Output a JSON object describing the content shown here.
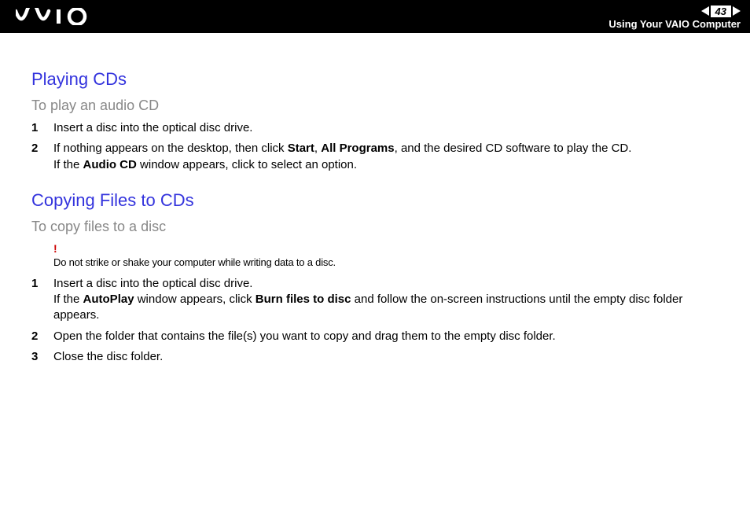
{
  "header": {
    "page_number": "43",
    "section_label": "Using Your VAIO Computer"
  },
  "sections": [
    {
      "title": "Playing CDs",
      "subtitle": "To play an audio CD",
      "steps": [
        {
          "lines": [
            {
              "parts": [
                {
                  "t": "Insert a disc into the optical disc drive."
                }
              ]
            }
          ]
        },
        {
          "lines": [
            {
              "parts": [
                {
                  "t": "If nothing appears on the desktop, then click "
                },
                {
                  "t": "Start",
                  "b": true
                },
                {
                  "t": ", "
                },
                {
                  "t": "All Programs",
                  "b": true
                },
                {
                  "t": ", and the desired CD software to play the CD."
                }
              ]
            },
            {
              "parts": [
                {
                  "t": "If the "
                },
                {
                  "t": "Audio CD",
                  "b": true
                },
                {
                  "t": " window appears, click to select an option."
                }
              ]
            }
          ]
        }
      ]
    },
    {
      "title": "Copying Files to CDs",
      "subtitle": "To copy files to a disc",
      "caution": "Do not strike or shake your computer while writing data to a disc.",
      "steps": [
        {
          "lines": [
            {
              "parts": [
                {
                  "t": "Insert a disc into the optical disc drive."
                }
              ]
            },
            {
              "parts": [
                {
                  "t": "If the "
                },
                {
                  "t": "AutoPlay",
                  "b": true
                },
                {
                  "t": " window appears, click "
                },
                {
                  "t": "Burn files to disc",
                  "b": true
                },
                {
                  "t": " and follow the on-screen instructions until the empty disc folder appears."
                }
              ]
            }
          ]
        },
        {
          "lines": [
            {
              "parts": [
                {
                  "t": "Open the folder that contains the file(s) you want to copy and drag them to the empty disc folder."
                }
              ]
            }
          ]
        },
        {
          "lines": [
            {
              "parts": [
                {
                  "t": "Close the disc folder."
                }
              ]
            }
          ]
        }
      ]
    }
  ]
}
